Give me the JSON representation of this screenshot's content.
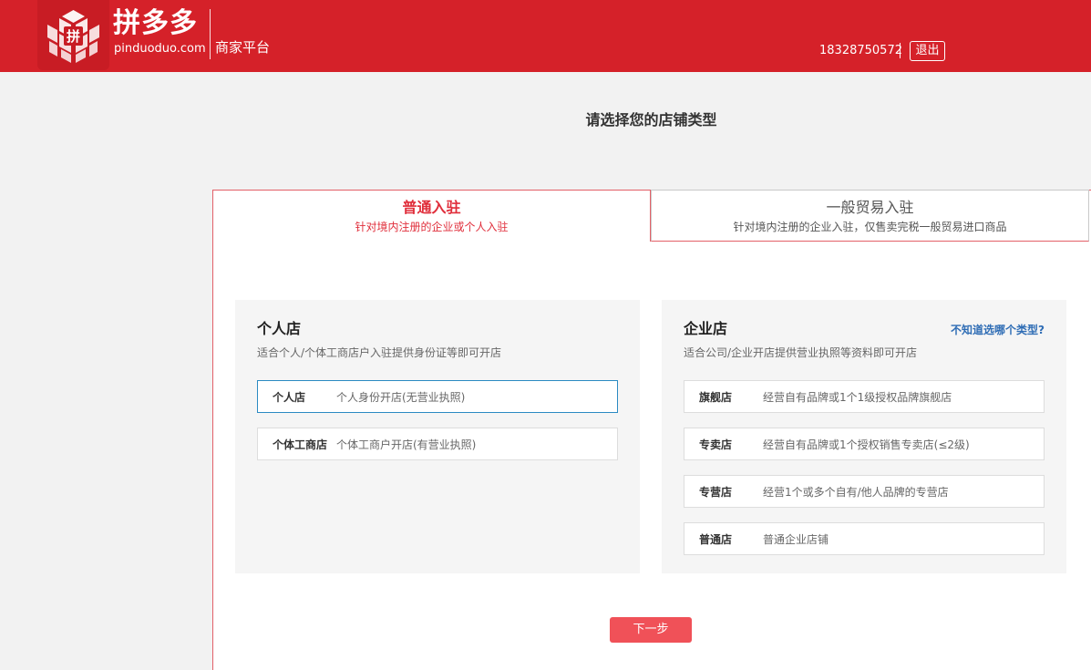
{
  "header": {
    "brand_cn": "拼多多",
    "brand_en": "pinduoduo.com",
    "platform": "商家平台",
    "phone": "18328750572",
    "logout_label": "退出",
    "logo_glyph": "拼",
    "colors": {
      "header_bg": "#d52129",
      "logo_bg": "#c81c24"
    }
  },
  "page_title": "请选择您的店铺类型",
  "tabs": [
    {
      "title": "普通入驻",
      "subtitle": "针对境内注册的企业或个人入驻",
      "active": true
    },
    {
      "title": "一般贸易入驻",
      "subtitle": "针对境内注册的企业入驻，仅售卖完税一般贸易进口商品",
      "active": false
    }
  ],
  "personal": {
    "title": "个人店",
    "desc": "适合个人/个体工商店户入驻提供身份证等即可开店",
    "options": [
      {
        "name": "个人店",
        "desc": "个人身份开店(无营业执照)",
        "selected": true
      },
      {
        "name": "个体工商店",
        "desc": "个体工商户开店(有营业执照)",
        "selected": false
      }
    ]
  },
  "enterprise": {
    "title": "企业店",
    "desc": "适合公司/企业开店提供营业执照等资料即可开店",
    "help_link": "不知道选哪个类型?",
    "options": [
      {
        "name": "旗舰店",
        "desc": "经营自有品牌或1个1级授权品牌旗舰店"
      },
      {
        "name": "专卖店",
        "desc": "经营自有品牌或1个授权销售专卖店(≤2级)"
      },
      {
        "name": "专营店",
        "desc": "经营1个或多个自有/他人品牌的专营店"
      },
      {
        "name": "普通店",
        "desc": "普通企业店铺"
      }
    ]
  },
  "next_label": "下一步",
  "colors": {
    "accent": "#e02e3b",
    "button": "#f05158",
    "link": "#2f6db5",
    "selected_border": "#2b8ac2"
  }
}
